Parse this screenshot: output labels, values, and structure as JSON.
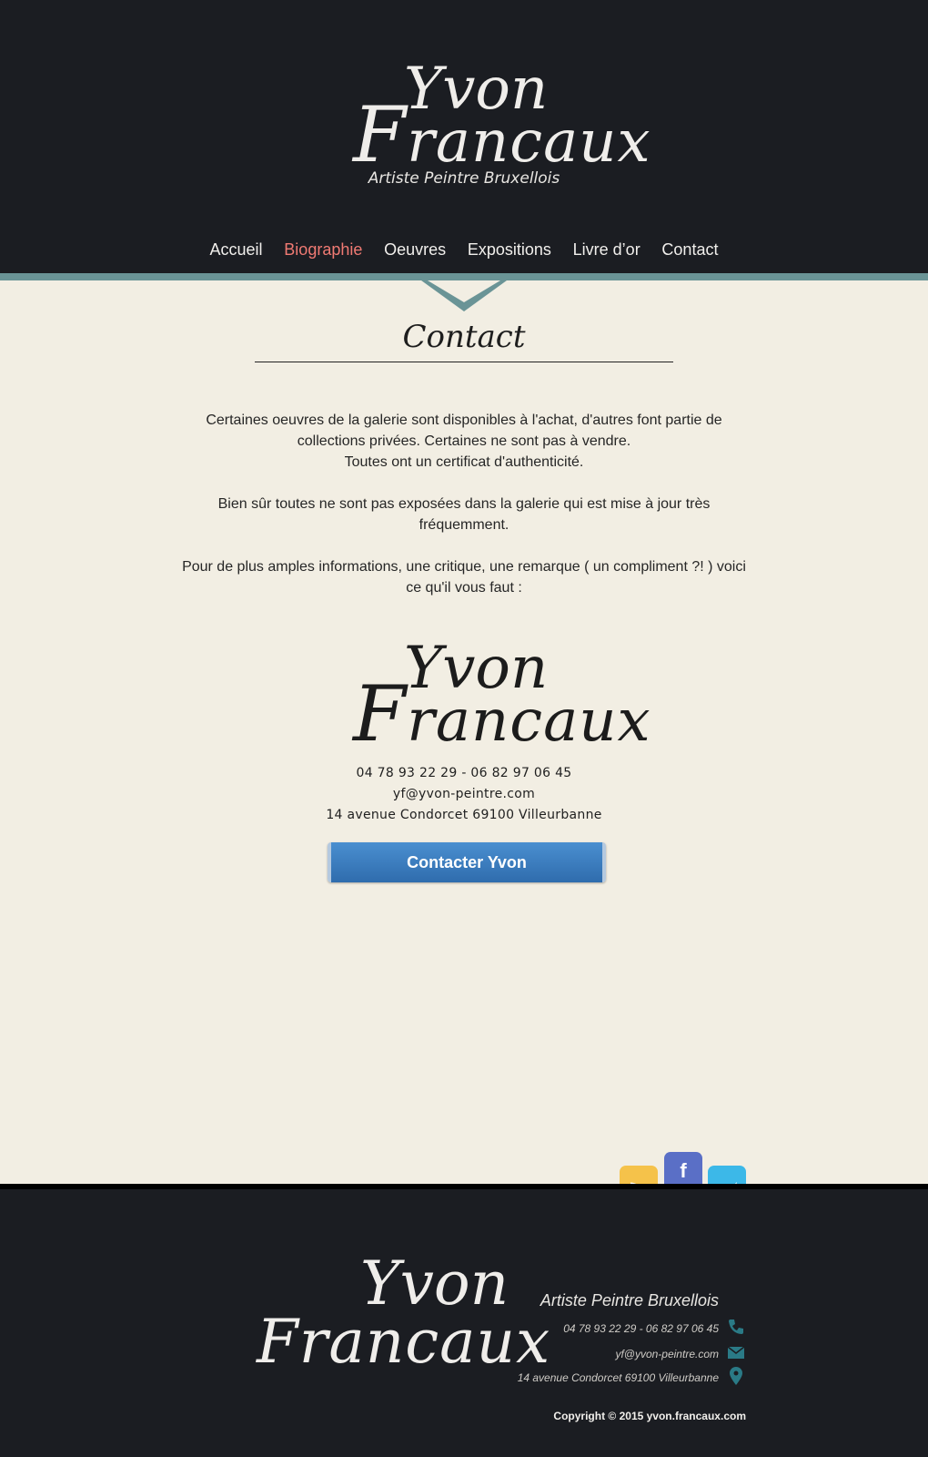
{
  "header": {
    "logo_first": "Yvon",
    "logo_last_initial": "F",
    "logo_last_rest": "rancaux",
    "tagline": "Artiste Peintre Bruxellois"
  },
  "nav": {
    "items": [
      {
        "label": "Accueil",
        "active": false
      },
      {
        "label": "Biographie",
        "active": true
      },
      {
        "label": "Oeuvres",
        "active": false
      },
      {
        "label": "Expositions",
        "active": false
      },
      {
        "label": "Livre d’or",
        "active": false
      },
      {
        "label": "Contact",
        "active": false
      }
    ],
    "active_color": "#f07a73"
  },
  "main": {
    "title": "Contact",
    "paragraphs": [
      "Certaines oeuvres de la galerie sont disponibles à l'achat, d'autres font partie de collections privées. Certaines ne sont pas à vendre.",
      "Toutes ont un certificat d'authenticité.",
      "Bien sûr toutes ne sont pas exposées dans la galerie qui est mise à jour très fréquemment.",
      "Pour de plus amples informations, une critique, une remarque ( un compliment ?! ) voici ce qu'il vous faut :"
    ],
    "logo_first": "Yvon",
    "logo_last_initial": "F",
    "logo_last_rest": "rancaux",
    "phone": "04 78 93 22 29 - 06 82 97 06 45",
    "email": "yf@yvon-peintre.com",
    "address": "14 avenue Condorcet 69100 Villeurbanne",
    "cta_label": "Contacter Yvon"
  },
  "social": {
    "rss_icon": "rss-icon",
    "facebook_label": "f",
    "twitter_icon": "twitter-icon"
  },
  "footer": {
    "logo_first": "Yvon",
    "logo_last": "Francaux",
    "tagline": "Artiste Peintre Bruxellois",
    "phone": "04 78 93 22 29 - 06 82 97 06 45",
    "email": "yf@yvon-peintre.com",
    "address": "14 avenue Condorcet  69100 Villeurbanne",
    "copyright": "Copyright © 2015 yvon.francaux.com",
    "accent_color": "#2a7a86"
  }
}
